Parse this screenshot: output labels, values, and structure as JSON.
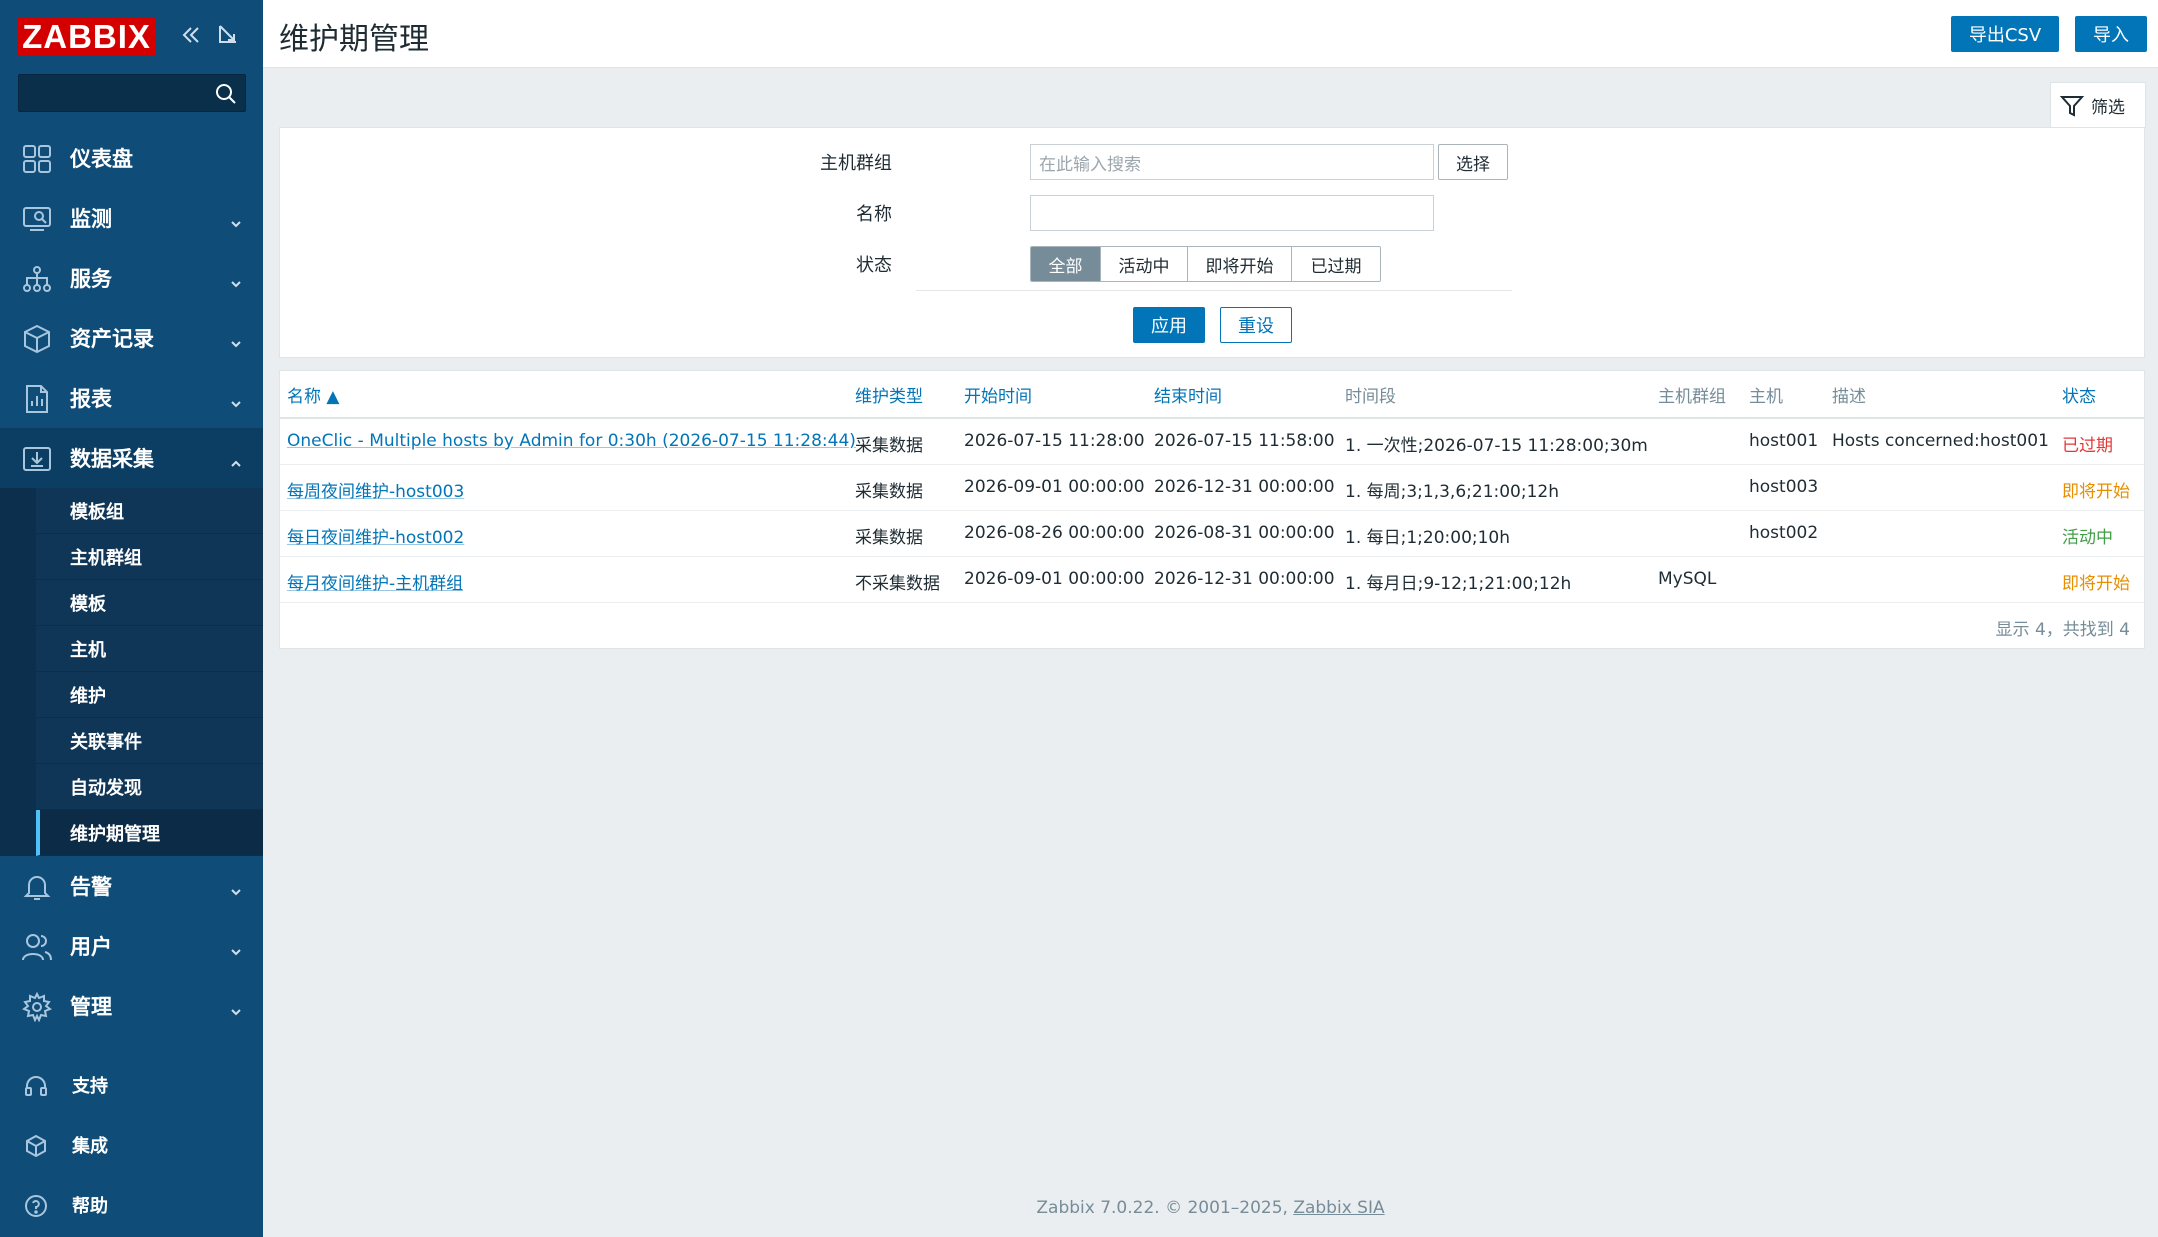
{
  "app": {
    "logo_text": "ZABBIX",
    "accent": "#0275b8",
    "brand_red": "#d40000",
    "sidebar_bg": "#0f4c78"
  },
  "sidebar": {
    "search_placeholder": "",
    "menu": [
      {
        "label": "仪表盘",
        "icon": "dashboard-icon",
        "expandable": false
      },
      {
        "label": "监测",
        "icon": "monitoring-icon",
        "expandable": true
      },
      {
        "label": "服务",
        "icon": "services-icon",
        "expandable": true
      },
      {
        "label": "资产记录",
        "icon": "inventory-icon",
        "expandable": true
      },
      {
        "label": "报表",
        "icon": "reports-icon",
        "expandable": true
      },
      {
        "label": "数据采集",
        "icon": "data-collection-icon",
        "expandable": true,
        "open": true
      }
    ],
    "submenu": [
      "模板组",
      "主机群组",
      "模板",
      "主机",
      "维护",
      "关联事件",
      "自动发现",
      "维护期管理"
    ],
    "submenu_active": "维护期管理",
    "menu_after": [
      {
        "label": "告警",
        "icon": "bell-icon"
      },
      {
        "label": "用户",
        "icon": "users-icon"
      },
      {
        "label": "管理",
        "icon": "gear-icon"
      }
    ],
    "bottom": [
      {
        "label": "支持",
        "icon": "headset-icon"
      },
      {
        "label": "集成",
        "icon": "integrations-icon"
      },
      {
        "label": "帮助",
        "icon": "help-icon"
      }
    ]
  },
  "header": {
    "title": "维护期管理",
    "export_label": "导出CSV",
    "import_label": "导入"
  },
  "filter": {
    "tab_label": "筛选",
    "host_group_label": "主机群组",
    "host_group_placeholder": "在此输入搜索",
    "select_label": "选择",
    "name_label": "名称",
    "name_value": "",
    "status_label": "状态",
    "status_options": [
      "全部",
      "活动中",
      "即将开始",
      "已过期"
    ],
    "status_selected": "全部",
    "apply_label": "应用",
    "reset_label": "重设"
  },
  "table": {
    "columns": [
      "名称 ▲",
      "维护类型",
      "开始时间",
      "结束时间",
      "时间段",
      "主机群组",
      "主机",
      "描述",
      "状态"
    ],
    "rows": [
      {
        "name": "OneClic - Multiple hosts by Admin for 0:30h (2026-07-15 11:28:44)",
        "type": "采集数据",
        "start": "2026-07-15 11:28:00",
        "end": "2026-07-15 11:58:00",
        "period": "1. 一次性;2026-07-15 11:28:00;30m",
        "groups": "",
        "hosts": "host001",
        "description": "Hosts concerned:host001",
        "status": "已过期",
        "status_kind": "expired"
      },
      {
        "name": "每周夜间维护-host003",
        "type": "采集数据",
        "start": "2026-09-01 00:00:00",
        "end": "2026-12-31 00:00:00",
        "period": "1. 每周;3;1,3,6;21:00;12h",
        "groups": "",
        "hosts": "host003",
        "description": "",
        "status": "即将开始",
        "status_kind": "soon"
      },
      {
        "name": "每日夜间维护-host002",
        "type": "采集数据",
        "start": "2026-08-26 00:00:00",
        "end": "2026-08-31 00:00:00",
        "period": "1. 每日;1;20:00;10h",
        "groups": "",
        "hosts": "host002",
        "description": "",
        "status": "活动中",
        "status_kind": "active"
      },
      {
        "name": "每月夜间维护-主机群组",
        "type": "不采集数据",
        "start": "2026-09-01 00:00:00",
        "end": "2026-12-31 00:00:00",
        "period": "1. 每月日;9-12;1;21:00;12h",
        "groups": "MySQL",
        "hosts": "",
        "description": "",
        "status": "即将开始",
        "status_kind": "soon"
      }
    ],
    "summary": "显示 4，共找到 4"
  },
  "footer": {
    "text": "Zabbix 7.0.22. © 2001–2025, ",
    "link": "Zabbix SIA"
  }
}
